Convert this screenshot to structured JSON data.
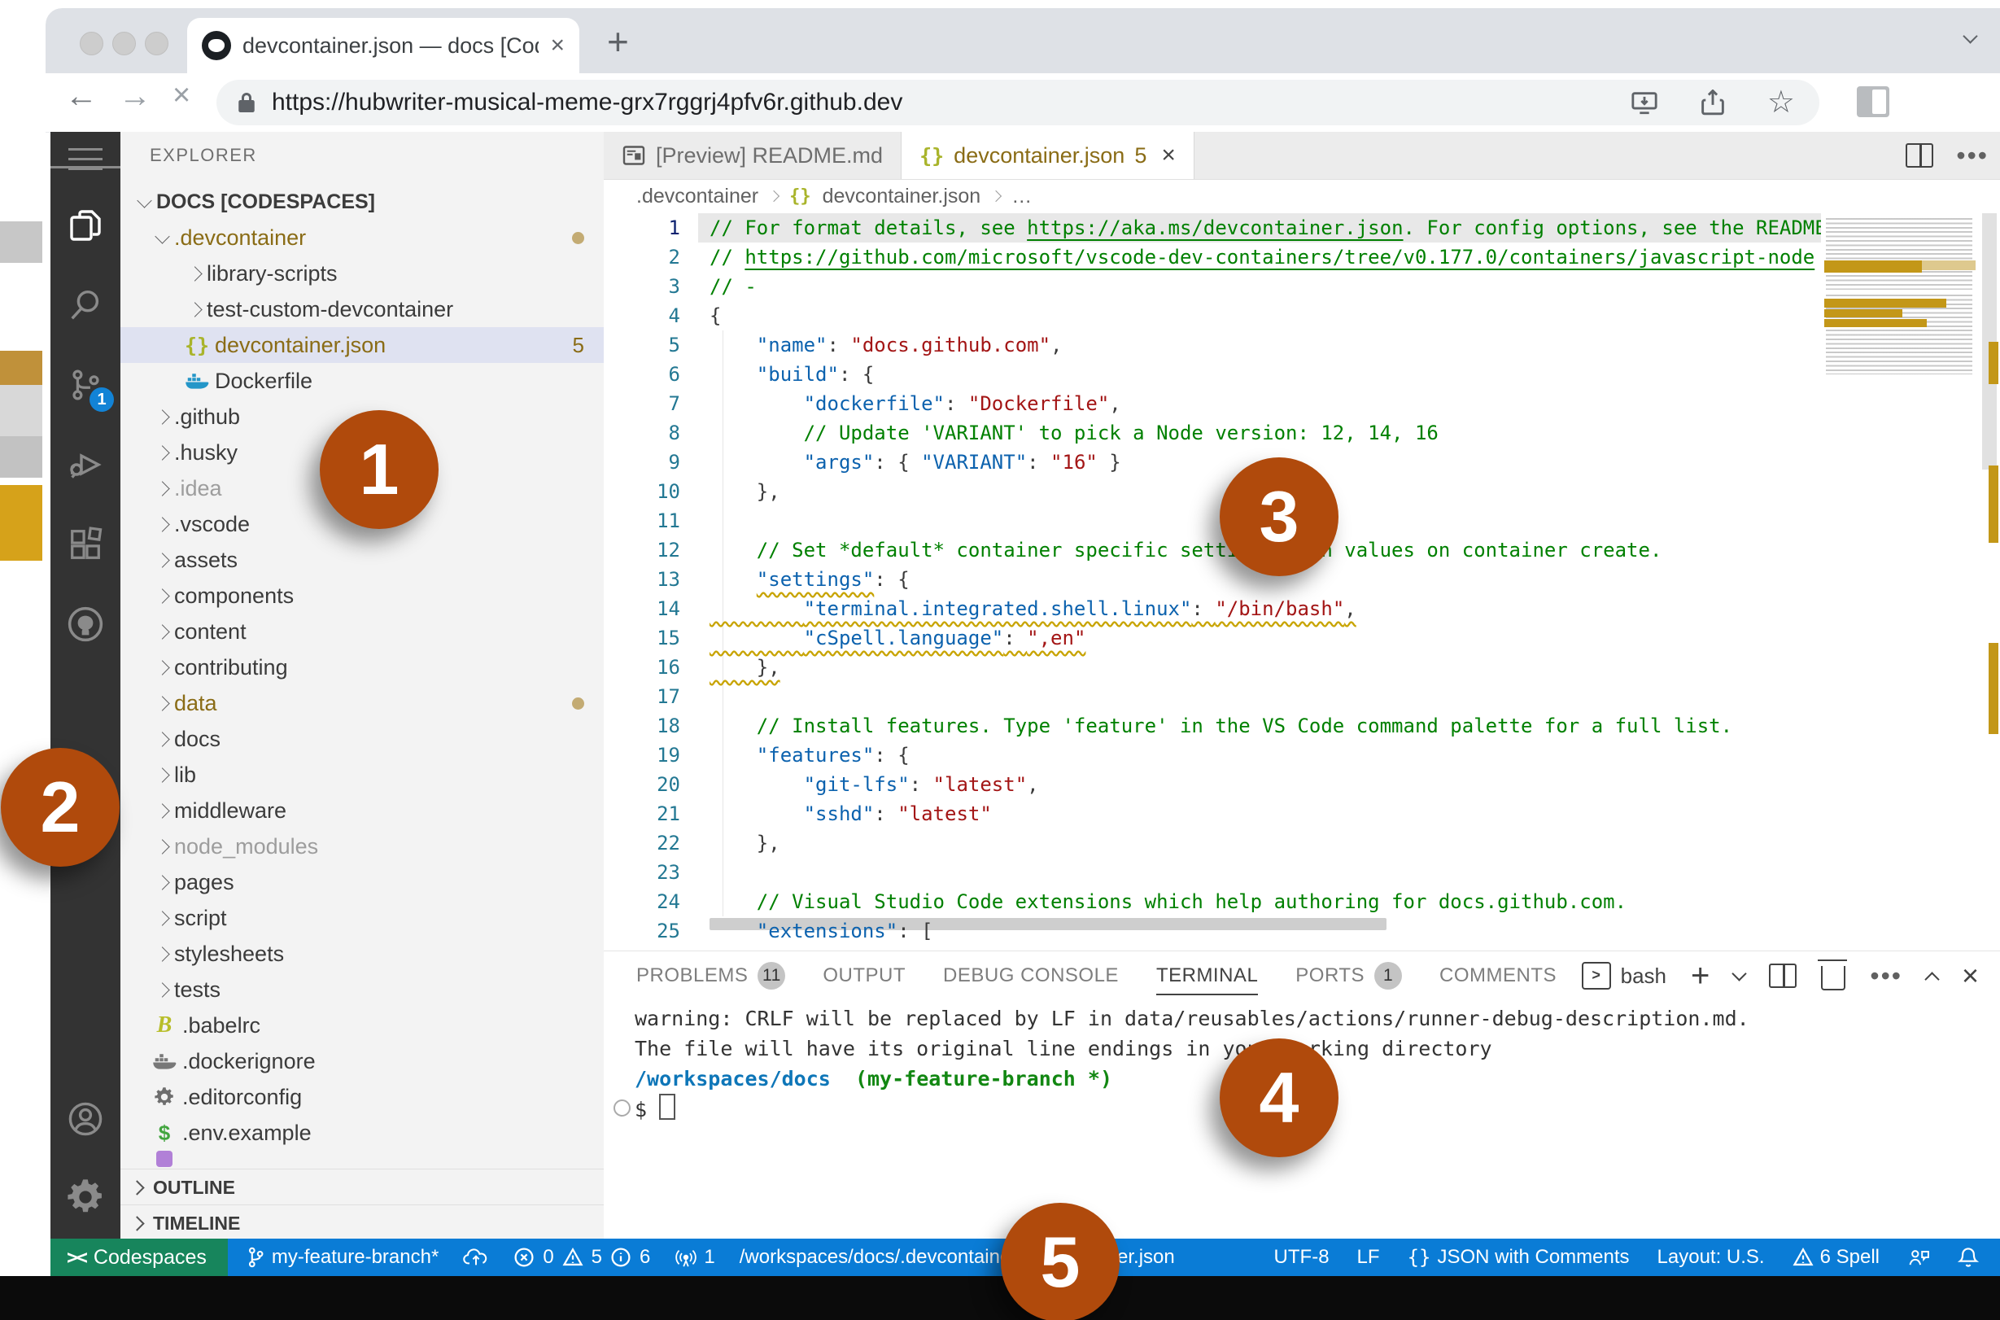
{
  "browser": {
    "tab_title": "devcontainer.json — docs [Cod",
    "url": "https://hubwriter-musical-meme-grx7rggrj4pfv6r.github.dev"
  },
  "activity_bar": {
    "source_control_badge": "1"
  },
  "explorer": {
    "title": "EXPLORER",
    "items": [
      {
        "label": "DOCS [CODESPACES]",
        "depth": 0,
        "chev": "down",
        "cls": "bold"
      },
      {
        "label": ".devcontainer",
        "depth": 1,
        "chev": "down",
        "cls": "gold",
        "dot": true
      },
      {
        "label": "library-scripts",
        "depth": 2,
        "chev": "right"
      },
      {
        "label": "test-custom-devcontainer",
        "depth": 2,
        "chev": "right"
      },
      {
        "label": "devcontainer.json",
        "depth": 2,
        "icon": "json",
        "cls": "gold",
        "badge": "5",
        "selected": true
      },
      {
        "label": "Dockerfile",
        "depth": 2,
        "icon": "docker"
      },
      {
        "label": ".github",
        "depth": 1,
        "chev": "right"
      },
      {
        "label": ".husky",
        "depth": 1,
        "chev": "right"
      },
      {
        "label": ".idea",
        "depth": 1,
        "chev": "right",
        "cls": "dim"
      },
      {
        "label": ".vscode",
        "depth": 1,
        "chev": "right"
      },
      {
        "label": "assets",
        "depth": 1,
        "chev": "right"
      },
      {
        "label": "components",
        "depth": 1,
        "chev": "right"
      },
      {
        "label": "content",
        "depth": 1,
        "chev": "right"
      },
      {
        "label": "contributing",
        "depth": 1,
        "chev": "right"
      },
      {
        "label": "data",
        "depth": 1,
        "chev": "right",
        "cls": "gold",
        "dot": true
      },
      {
        "label": "docs",
        "depth": 1,
        "chev": "right"
      },
      {
        "label": "lib",
        "depth": 1,
        "chev": "right"
      },
      {
        "label": "middleware",
        "depth": 1,
        "chev": "right"
      },
      {
        "label": "node_modules",
        "depth": 1,
        "chev": "right",
        "cls": "dim"
      },
      {
        "label": "pages",
        "depth": 1,
        "chev": "right"
      },
      {
        "label": "script",
        "depth": 1,
        "chev": "right"
      },
      {
        "label": "stylesheets",
        "depth": 1,
        "chev": "right"
      },
      {
        "label": "tests",
        "depth": 1,
        "chev": "right"
      },
      {
        "label": ".babelrc",
        "depth": 1,
        "icon": "babel"
      },
      {
        "label": ".dockerignore",
        "depth": 1,
        "icon": "dockergray"
      },
      {
        "label": ".editorconfig",
        "depth": 1,
        "icon": "gear"
      },
      {
        "label": ".env.example",
        "depth": 1,
        "icon": "env"
      },
      {
        "label": "",
        "depth": 1,
        "icon": "purple",
        "partial": true
      }
    ],
    "outline_label": "OUTLINE",
    "timeline_label": "TIMELINE"
  },
  "editor": {
    "tab_preview": "[Preview] README.md",
    "tab_active": "devcontainer.json",
    "tab_active_badge": "5",
    "breadcrumb_a": ".devcontainer",
    "breadcrumb_icon": "{}",
    "breadcrumb_b": "devcontainer.json",
    "breadcrumb_c": "…",
    "lines": [
      {
        "hl": true,
        "t": [
          [
            "c",
            "// For format details, see "
          ],
          [
            "c u",
            "https://aka.ms/devcontainer.json"
          ],
          [
            "c",
            ". For config options, see the README"
          ]
        ]
      },
      {
        "t": [
          [
            "c",
            "// "
          ],
          [
            "c u",
            "https://github.com/microsoft/vscode-dev-containers/tree/v0.177.0/containers/javascript-node"
          ]
        ]
      },
      {
        "t": [
          [
            "c",
            "// -"
          ]
        ]
      },
      {
        "t": [
          [
            "p",
            "{"
          ]
        ]
      },
      {
        "t": [
          [
            "p",
            "    "
          ],
          [
            "k",
            "\"name\""
          ],
          [
            "p",
            ": "
          ],
          [
            "s",
            "\"docs.github.com\""
          ],
          [
            "p",
            ","
          ]
        ]
      },
      {
        "t": [
          [
            "p",
            "    "
          ],
          [
            "k",
            "\"build\""
          ],
          [
            "p",
            ": {"
          ]
        ]
      },
      {
        "t": [
          [
            "p",
            "        "
          ],
          [
            "k",
            "\"dockerfile\""
          ],
          [
            "p",
            ": "
          ],
          [
            "s",
            "\"Dockerfile\""
          ],
          [
            "p",
            ","
          ]
        ]
      },
      {
        "t": [
          [
            "p",
            "        "
          ],
          [
            "c",
            "// Update 'VARIANT' to pick a Node version: 12, 14, 16"
          ]
        ]
      },
      {
        "t": [
          [
            "p",
            "        "
          ],
          [
            "k",
            "\"args\""
          ],
          [
            "p",
            ": { "
          ],
          [
            "k",
            "\"VARIANT\""
          ],
          [
            "p",
            ": "
          ],
          [
            "s",
            "\"16\""
          ],
          [
            "p",
            " }"
          ]
        ]
      },
      {
        "t": [
          [
            "p",
            "    },"
          ]
        ]
      },
      {
        "t": []
      },
      {
        "t": [
          [
            "p",
            "    "
          ],
          [
            "c",
            "// Set *default* container specific settings.json values on container create."
          ]
        ]
      },
      {
        "t": [
          [
            "p",
            "    "
          ],
          [
            "k sq",
            "\"settings\""
          ],
          [
            "p",
            ": {"
          ]
        ]
      },
      {
        "sq": true,
        "t": [
          [
            "p",
            "        "
          ],
          [
            "k",
            "\"terminal.integrated.shell.linux\""
          ],
          [
            "p",
            ": "
          ],
          [
            "s",
            "\"/bin/bash\""
          ],
          [
            "p",
            ","
          ]
        ]
      },
      {
        "sq": true,
        "t": [
          [
            "p",
            "        "
          ],
          [
            "k",
            "\"cSpell.language\""
          ],
          [
            "p",
            ": "
          ],
          [
            "s",
            "\",en\""
          ]
        ]
      },
      {
        "sq": true,
        "t": [
          [
            "p",
            "    },"
          ]
        ]
      },
      {
        "t": []
      },
      {
        "t": [
          [
            "p",
            "    "
          ],
          [
            "c",
            "// Install features. Type 'feature' in the VS Code command palette for a full list."
          ]
        ]
      },
      {
        "t": [
          [
            "p",
            "    "
          ],
          [
            "k",
            "\"features\""
          ],
          [
            "p",
            ": {"
          ]
        ]
      },
      {
        "t": [
          [
            "p",
            "        "
          ],
          [
            "k",
            "\"git-lfs\""
          ],
          [
            "p",
            ": "
          ],
          [
            "s",
            "\"latest\""
          ],
          [
            "p",
            ","
          ]
        ]
      },
      {
        "t": [
          [
            "p",
            "        "
          ],
          [
            "k",
            "\"sshd\""
          ],
          [
            "p",
            ": "
          ],
          [
            "s",
            "\"latest\""
          ]
        ]
      },
      {
        "t": [
          [
            "p",
            "    },"
          ]
        ]
      },
      {
        "t": []
      },
      {
        "t": [
          [
            "p",
            "    "
          ],
          [
            "c",
            "// Visual Studio Code extensions which help authoring for docs.github.com."
          ]
        ]
      },
      {
        "t": [
          [
            "p",
            "    "
          ],
          [
            "k",
            "\"extensions\""
          ],
          [
            "p",
            ": ["
          ]
        ]
      }
    ]
  },
  "panel": {
    "tabs": [
      {
        "label": "PROBLEMS",
        "badge": "11"
      },
      {
        "label": "OUTPUT"
      },
      {
        "label": "DEBUG CONSOLE"
      },
      {
        "label": "TERMINAL",
        "active": true
      },
      {
        "label": "PORTS",
        "badge": "1"
      },
      {
        "label": "COMMENTS"
      }
    ],
    "shell_label": "bash",
    "terminal_lines": [
      [
        [
          "plain",
          "warning: CRLF will be replaced by LF in data/reusables/actions/runner-debug-description.md."
        ]
      ],
      [
        [
          "plain",
          "The file will have its original line endings in your working directory"
        ]
      ],
      [
        [
          "path",
          "/workspaces/docs"
        ],
        [
          "plain",
          "  "
        ],
        [
          "branch",
          "(my-feature-branch *)"
        ]
      ],
      [
        [
          "prompt",
          "$ "
        ]
      ]
    ]
  },
  "status_bar": {
    "remote": "Codespaces",
    "branch": "my-feature-branch*",
    "errors": "0",
    "warnings": "5",
    "infos": "6",
    "ports": "1",
    "path": "/workspaces/docs/.devcontainer/devcontainer.json",
    "encoding": "UTF-8",
    "eol": "LF",
    "mode_icon": "{}",
    "mode": "JSON with Comments",
    "layout": "Layout: U.S.",
    "spell": "6 Spell"
  },
  "annotations": {
    "color": "#b04a0c",
    "items": [
      "1",
      "2",
      "3",
      "4",
      "5"
    ]
  },
  "colors": {
    "statusbar_blue": "#0a7cd6",
    "remote_green": "#17855c",
    "annotation_orange": "#b04a0c",
    "modified_gold": "#8a6c16",
    "activity_bar": "#333333"
  }
}
